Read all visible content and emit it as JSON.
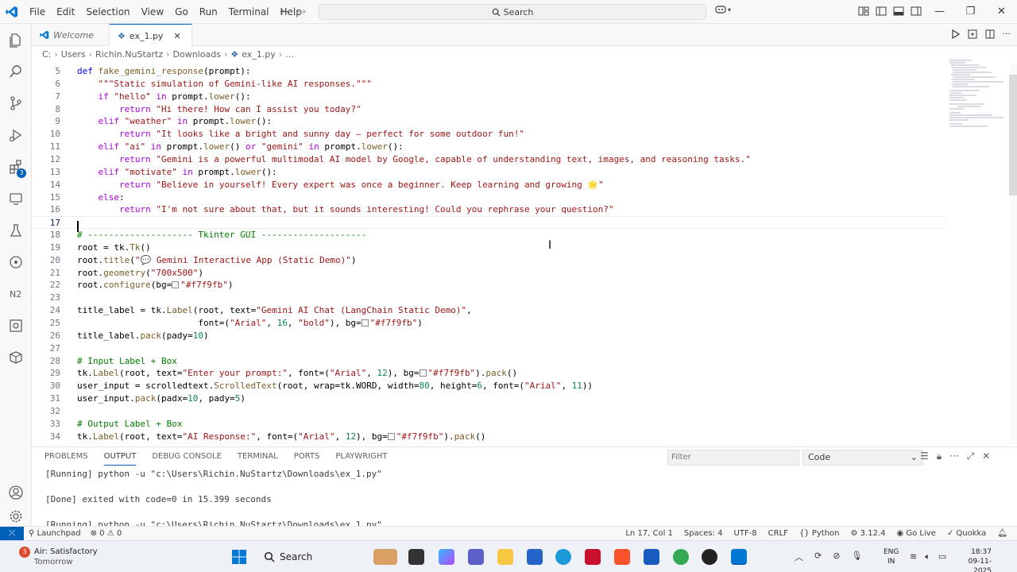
{
  "menu": [
    "File",
    "Edit",
    "Selection",
    "View",
    "Go",
    "Run",
    "Terminal",
    "Help"
  ],
  "search": {
    "label": "Search"
  },
  "tabs": [
    {
      "label": "Welcome"
    },
    {
      "label": "ex_1.py"
    }
  ],
  "breadcrumb": [
    "C:",
    "Users",
    "Richin.NuStartz",
    "Downloads",
    "ex_1.py",
    "..."
  ],
  "activity_badge": "3",
  "editor": {
    "lines": [
      {
        "n": "5",
        "t": "def fake_gemini_response(prompt):"
      },
      {
        "n": "6",
        "t": "    \"\"\"Static simulation of Gemini-like AI responses.\"\"\""
      },
      {
        "n": "7",
        "t": "    if \"hello\" in prompt.lower():"
      },
      {
        "n": "8",
        "t": "        return \"Hi there! How can I assist you today?\""
      },
      {
        "n": "9",
        "t": "    elif \"weather\" in prompt.lower():"
      },
      {
        "n": "10",
        "t": "        return \"It looks like a bright and sunny day — perfect for some outdoor fun!\""
      },
      {
        "n": "11",
        "t": "    elif \"ai\" in prompt.lower() or \"gemini\" in prompt.lower():"
      },
      {
        "n": "12",
        "t": "        return \"Gemini is a powerful multimodal AI model by Google, capable of understanding text, images, and reasoning tasks.\""
      },
      {
        "n": "13",
        "t": "    elif \"motivate\" in prompt.lower():"
      },
      {
        "n": "14",
        "t": "        return \"Believe in yourself! Every expert was once a beginner. Keep learning and growing 🌟\""
      },
      {
        "n": "15",
        "t": "    else:"
      },
      {
        "n": "16",
        "t": "        return \"I'm not sure about that, but it sounds interesting! Could you rephrase your question?\""
      },
      {
        "n": "17",
        "t": ""
      },
      {
        "n": "18",
        "t": "# -------------------- Tkinter GUI --------------------"
      },
      {
        "n": "19",
        "t": "root = tk.Tk()"
      },
      {
        "n": "20",
        "t": "root.title(\"💬 Gemini Interactive App (Static Demo)\")"
      },
      {
        "n": "21",
        "t": "root.geometry(\"700x500\")"
      },
      {
        "n": "22",
        "t": "root.configure(bg=\"#f7f9fb\")"
      },
      {
        "n": "23",
        "t": ""
      },
      {
        "n": "24",
        "t": "title_label = tk.Label(root, text=\"Gemini AI Chat (LangChain Static Demo)\","
      },
      {
        "n": "25",
        "t": "                       font=(\"Arial\", 16, \"bold\"), bg=\"#f7f9fb\")"
      },
      {
        "n": "26",
        "t": "title_label.pack(pady=10)"
      },
      {
        "n": "27",
        "t": ""
      },
      {
        "n": "28",
        "t": "# Input Label + Box"
      },
      {
        "n": "29",
        "t": "tk.Label(root, text=\"Enter your prompt:\", font=(\"Arial\", 12), bg=\"#f7f9fb\").pack()"
      },
      {
        "n": "30",
        "t": "user_input = scrolledtext.ScrolledText(root, wrap=tk.WORD, width=80, height=6, font=(\"Arial\", 11))"
      },
      {
        "n": "31",
        "t": "user_input.pack(padx=10, pady=5)"
      },
      {
        "n": "32",
        "t": ""
      },
      {
        "n": "33",
        "t": "# Output Label + Box"
      },
      {
        "n": "34",
        "t": "tk.Label(root, text=\"AI Response:\", font=(\"Arial\", 12), bg=\"#f7f9fb\").pack()"
      }
    ]
  },
  "panel": {
    "tabs": [
      "PROBLEMS",
      "OUTPUT",
      "DEBUG CONSOLE",
      "TERMINAL",
      "PORTS",
      "PLAYWRIGHT"
    ],
    "active_tab": "OUTPUT",
    "filter_placeholder": "Filter",
    "channel": "Code",
    "output": {
      "run1": "[Running] python -u \"c:\\Users\\Richin.NuStartz\\Downloads\\ex_1.py\"",
      "done": "[Done] exited with code=0 in 15.399 seconds",
      "run2": "[Running] python -u \"c:\\Users\\Richin.NuStartz\\Downloads\\ex_1.py\""
    }
  },
  "statusbar": {
    "launchpad": "Launchpad",
    "errors": "0",
    "warnings": "0",
    "position": "Ln 17, Col 1",
    "spaces": "Spaces: 4",
    "encoding": "UTF-8",
    "eol": "CRLF",
    "language": "Python",
    "version": "3.12.4",
    "golive": "Go Live",
    "quokka": "Quokka"
  },
  "taskbar": {
    "weather_title": "Air: Satisfactory",
    "weather_sub": "Tomorrow",
    "weather_badge": "3",
    "search": "Search",
    "lang1": "ENG",
    "lang2": "IN",
    "time": "18:37",
    "date": "09-11-2025"
  },
  "colors": {
    "accent": "#005fb8",
    "keyword": "#af00db",
    "string": "#a31515",
    "comment": "#008000",
    "function": "#795e26"
  }
}
